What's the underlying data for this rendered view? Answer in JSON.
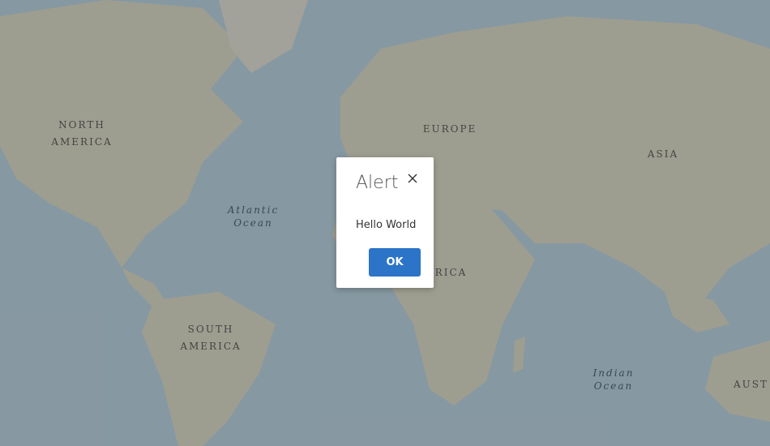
{
  "map": {
    "continents": {
      "north_america": [
        "NORTH",
        "AMERICA"
      ],
      "europe": "EUROPE",
      "asia": "ASIA",
      "africa": "AFRICA",
      "south_america": [
        "SOUTH",
        "AMERICA"
      ],
      "australia": "AUST"
    },
    "oceans": {
      "atlantic": [
        "Atlantic",
        "Ocean"
      ],
      "indian": [
        "Indian",
        "Ocean"
      ]
    },
    "colors": {
      "ocean": "#a9c5d6",
      "land": "#cfcfb8",
      "overlay": "#505050"
    }
  },
  "dialog": {
    "title": "Alert",
    "message": "Hello World",
    "ok_label": "OK",
    "close_icon": "close-icon",
    "accent": "#2b74c7"
  }
}
